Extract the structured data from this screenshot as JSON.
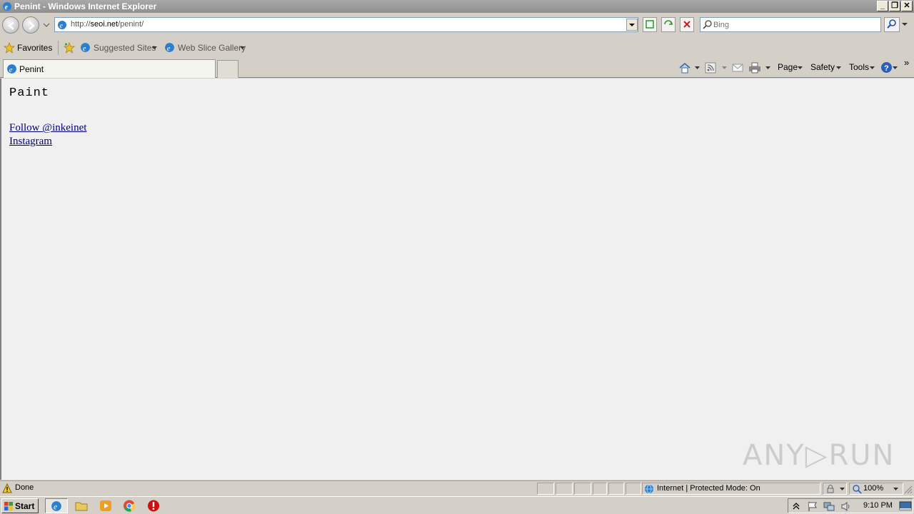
{
  "window": {
    "title": "Penint - Windows Internet Explorer",
    "minimize_glyph": "_",
    "restore_glyph": "❐",
    "close_glyph": "✕"
  },
  "address_bar": {
    "url_prefix": "http://",
    "url_domain": "seoi.net",
    "url_path": "/penint/",
    "search_placeholder": "Bing"
  },
  "favorites_bar": {
    "favorites_label": "Favorites",
    "items": [
      {
        "label": "Suggested Sites"
      },
      {
        "label": "Web Slice Gallery"
      }
    ]
  },
  "tabs": [
    {
      "label": "Penint"
    }
  ],
  "command_bar": {
    "page_label": "Page",
    "safety_label": "Safety",
    "tools_label": "Tools",
    "more_glyph": "»"
  },
  "page": {
    "heading": "Paint",
    "links": [
      {
        "label": "Follow @inkeinet"
      },
      {
        "label": "Instagram"
      }
    ],
    "watermark": "ANY▷RUN"
  },
  "status_bar": {
    "status": "Done",
    "zone": "Internet | Protected Mode: On",
    "zoom": "100%"
  },
  "taskbar": {
    "start_label": "Start",
    "clock": "9:10 PM"
  },
  "colors": {
    "title_bar": "#9a9a9a",
    "content_bg": "#f0f0f0",
    "link": "#00007f"
  }
}
